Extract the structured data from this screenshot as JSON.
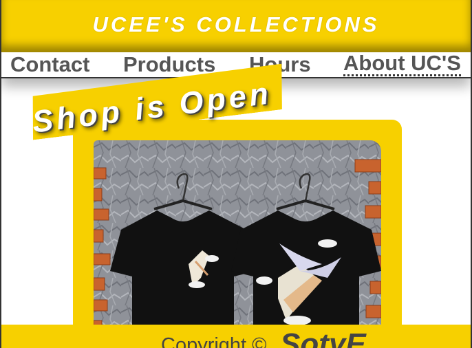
{
  "header": {
    "title": "UCEE'S COLLECTIONS"
  },
  "nav": {
    "items": [
      {
        "label": "Contact"
      },
      {
        "label": "Products"
      },
      {
        "label": "Hours"
      },
      {
        "label": "About UC'S"
      }
    ]
  },
  "hero": {
    "banner": "Shop is Open"
  },
  "footer": {
    "copyright": "Copyright ©",
    "brand": "SotyE"
  },
  "colors": {
    "accent": "#f7d000",
    "text": "#555555"
  }
}
